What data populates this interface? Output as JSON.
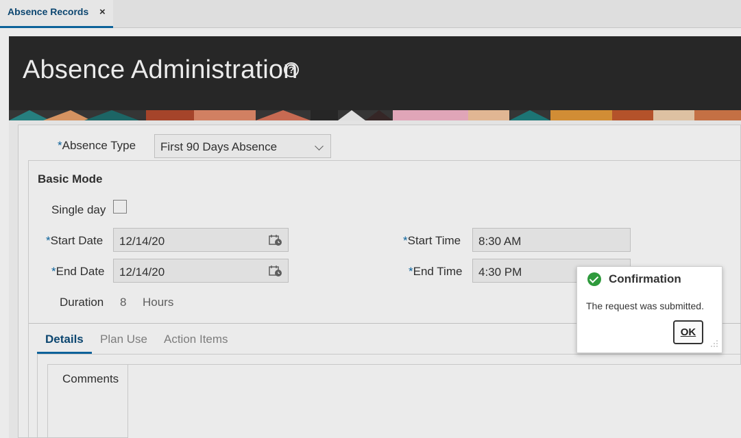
{
  "tabs": [
    {
      "label": "Absence Records",
      "close": "×"
    }
  ],
  "banner": {
    "title": "Absence Administration",
    "help": "?"
  },
  "form": {
    "absence_type": {
      "label": "Absence Type",
      "required": "*",
      "value": "First 90 Days Absence"
    },
    "section_title": "Basic Mode",
    "single_day": {
      "label": "Single day",
      "checked": false
    },
    "start_date": {
      "label": "Start Date",
      "required": "*",
      "value": "12/14/20"
    },
    "end_date": {
      "label": "End Date",
      "required": "*",
      "value": "12/14/20"
    },
    "start_time": {
      "label": "Start Time",
      "required": "*",
      "value": "8:30 AM"
    },
    "end_time": {
      "label": "End Time",
      "required": "*",
      "value": "4:30 PM"
    },
    "duration": {
      "label": "Duration",
      "value": "8",
      "unit": "Hours"
    }
  },
  "subtabs": [
    {
      "label": "Details",
      "active": true
    },
    {
      "label": "Plan Use",
      "active": false
    },
    {
      "label": "Action Items",
      "active": false
    }
  ],
  "details": {
    "comments_label": "Comments"
  },
  "dialog": {
    "title": "Confirmation",
    "message": "The request was submitted.",
    "ok_label": "OK"
  },
  "colors": {
    "accent": "#0e6ba8",
    "success": "#2e9a3c",
    "banner": "#2b2b2b"
  }
}
